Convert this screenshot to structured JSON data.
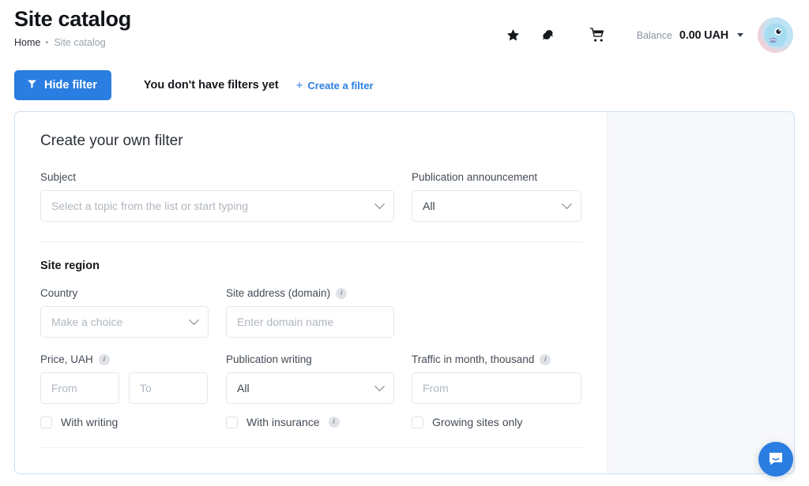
{
  "header": {
    "title": "Site catalog",
    "breadcrumb": {
      "home": "Home",
      "current": "Site catalog"
    },
    "icons": {
      "favorites": "star-icon",
      "messages": "chat-bubbles-icon",
      "cart": "shopping-cart-icon",
      "avatar": "user-avatar"
    },
    "balance": {
      "label": "Balance",
      "value": "0.00 UAH"
    }
  },
  "filter_bar": {
    "hide_filter_label": "Hide filter",
    "hide_filter_icon": "funnel-icon",
    "empty_state_text": "You don't have filters yet",
    "create_filter_label": "Create a filter",
    "create_filter_icon": "plus-icon"
  },
  "panel": {
    "title": "Create your own filter",
    "subject": {
      "label": "Subject",
      "placeholder": "Select a topic from the list or start typing",
      "value": ""
    },
    "publication_announcement": {
      "label": "Publication announcement",
      "value": "All"
    },
    "site_region": {
      "section_title": "Site region",
      "country": {
        "label": "Country",
        "placeholder": "Make a choice",
        "value": ""
      },
      "site_address": {
        "label": "Site address (domain)",
        "info": "i",
        "placeholder": "Enter domain name",
        "value": ""
      },
      "price": {
        "label": "Price, UAH",
        "info": "i",
        "from_placeholder": "From",
        "to_placeholder": "To",
        "from_value": "",
        "to_value": "",
        "checkbox_label": "With writing",
        "checkbox_checked": false
      },
      "publication_writing": {
        "label": "Publication writing",
        "value": "All",
        "checkbox_label": "With insurance",
        "checkbox_info": "i",
        "checkbox_checked": false
      },
      "traffic": {
        "label": "Traffic in month, thousand",
        "info": "i",
        "placeholder": "From",
        "value": "",
        "checkbox_label": "Growing sites only",
        "checkbox_checked": false
      }
    }
  },
  "chat": {
    "icon": "chat-launcher-icon"
  },
  "colors": {
    "accent": "#2a7de1",
    "panel_border": "#cfdfee",
    "text": "#15181c",
    "muted": "#8b949e",
    "placeholder": "#b0b7bf"
  }
}
